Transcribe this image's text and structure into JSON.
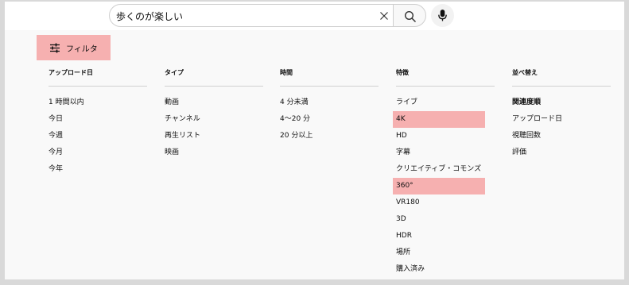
{
  "search": {
    "query": "歩くのが楽しい"
  },
  "filter_button": {
    "label": "フィルタ"
  },
  "columns": [
    {
      "heading": "アップロード日",
      "items": [
        "1 時間以内",
        "今日",
        "今週",
        "今月",
        "今年"
      ]
    },
    {
      "heading": "タイプ",
      "items": [
        "動画",
        "チャンネル",
        "再生リスト",
        "映画"
      ]
    },
    {
      "heading": "時間",
      "items": [
        "4 分未満",
        "4〜20 分",
        "20 分以上"
      ]
    },
    {
      "heading": "特徴",
      "items": [
        "ライブ",
        "4K",
        "HD",
        "字幕",
        "クリエイティブ・コモンズ",
        "360°",
        "VR180",
        "3D",
        "HDR",
        "場所",
        "購入済み"
      ],
      "highlighted": [
        "4K",
        "360°"
      ]
    },
    {
      "heading": "並べ替え",
      "items": [
        "関連度順",
        "アップロード日",
        "視聴回数",
        "評価"
      ],
      "selected": "関連度順"
    }
  ],
  "colors": {
    "highlight": "#f6b0b0",
    "background": "#f9f9f9",
    "outer_border": "#d9d9d9"
  }
}
